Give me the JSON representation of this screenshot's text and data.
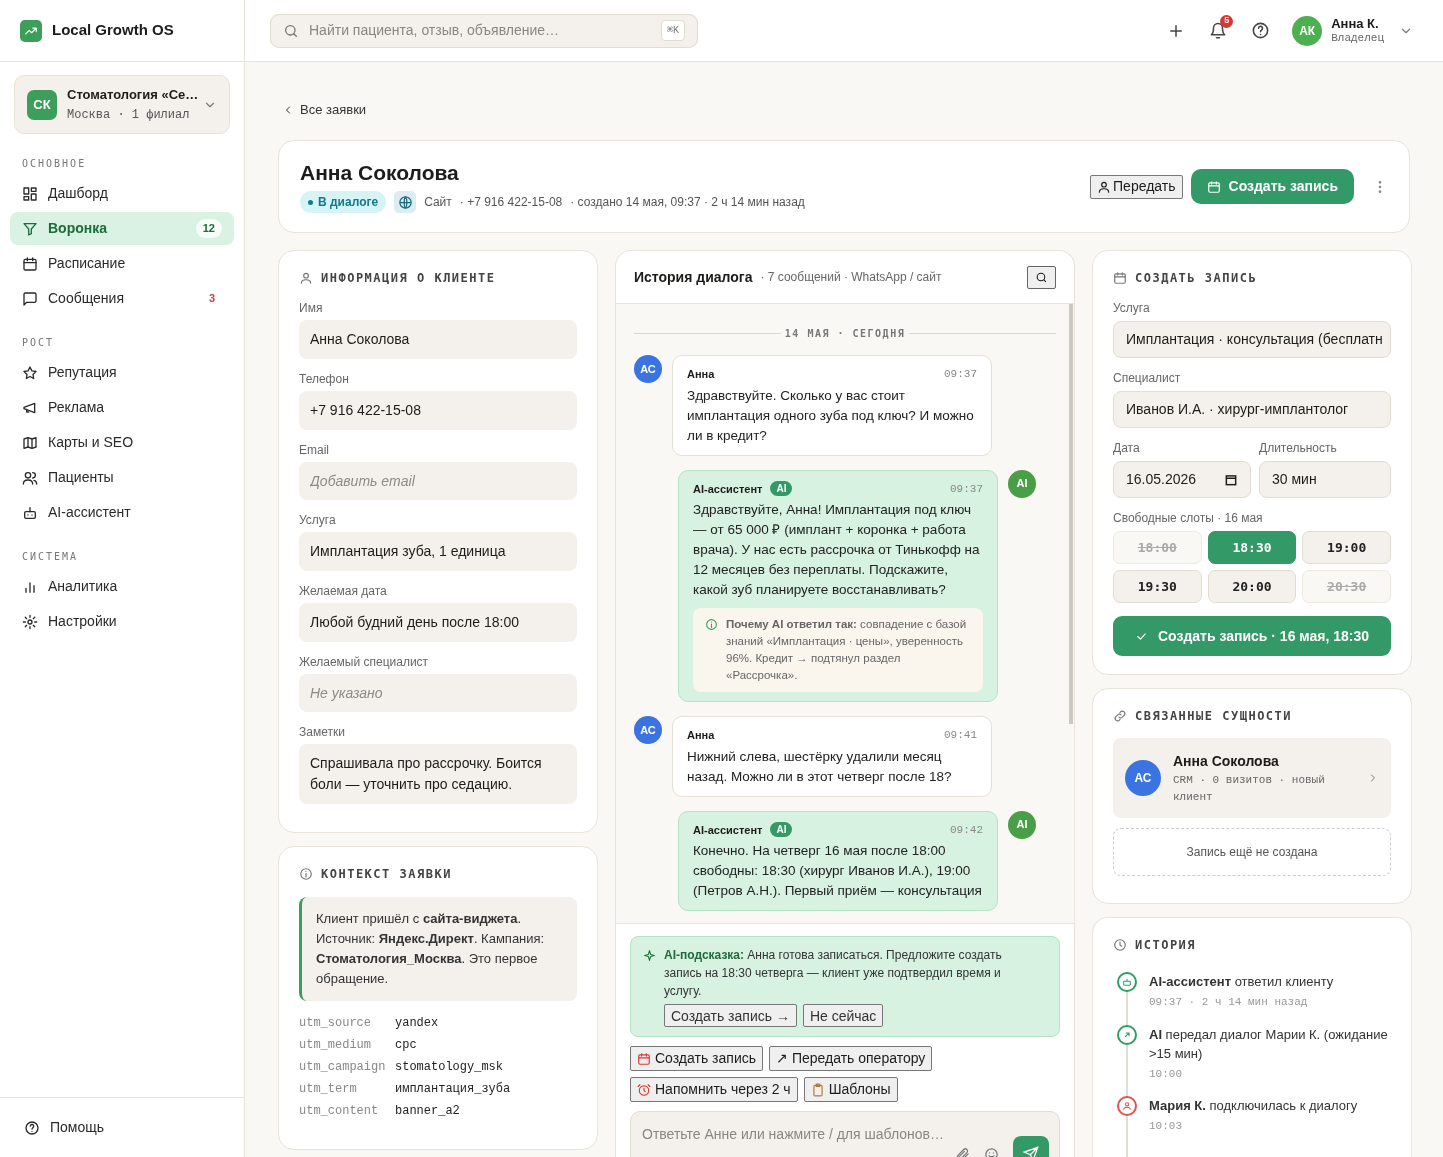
{
  "app": {
    "name": "Local Growth OS"
  },
  "search": {
    "placeholder": "Найти пациента, отзыв, объявление…",
    "shortcut": "⌘K"
  },
  "topbar": {
    "notifications": "5",
    "user": {
      "initials": "АК",
      "name": "Анна К.",
      "role": "Владелец"
    }
  },
  "org": {
    "initials": "СК",
    "name": "Стоматология «Се…",
    "meta": "Москва · 1 филиал"
  },
  "nav": [
    {
      "section": "ОСНОВНОЕ",
      "items": [
        {
          "label": "Дашборд",
          "selected": false
        },
        {
          "label": "Воронка",
          "selected": true,
          "badge": {
            "text": "12",
            "color": "#1f6b3d"
          }
        },
        {
          "label": "Расписание",
          "selected": false
        },
        {
          "label": "Сообщения",
          "selected": false,
          "badge": {
            "text": "3",
            "color": "#d23b3b"
          }
        }
      ]
    },
    {
      "section": "РОСТ",
      "items": [
        {
          "label": "Репутация",
          "selected": false
        },
        {
          "label": "Реклама",
          "selected": false
        },
        {
          "label": "Карты и SEO",
          "selected": false
        },
        {
          "label": "Пациенты",
          "selected": false
        },
        {
          "label": "AI-ассистент",
          "selected": false
        }
      ]
    },
    {
      "section": "СИСТЕМА",
      "items": [
        {
          "label": "Аналитика",
          "selected": false
        },
        {
          "label": "Настройки",
          "selected": false
        }
      ]
    }
  ],
  "help": "Помощь",
  "back": "Все заявки",
  "lead": {
    "name": "Анна Соколова",
    "status": "В диалоге",
    "source": "Сайт",
    "phone": "· +7 916 422-15-08",
    "created": "· создано 14 мая, 09:37 · 2 ч 14 мин назад",
    "actions": {
      "transfer": "Передать",
      "create": "Создать запись"
    }
  },
  "client_info": {
    "title": "ИНФОРМАЦИЯ О КЛИЕНТЕ",
    "fields": [
      {
        "label": "Имя",
        "value": "Анна Соколова"
      },
      {
        "label": "Телефон",
        "value": "+7 916 422-15-08"
      },
      {
        "label": "Email",
        "placeholder": "Добавить email"
      },
      {
        "label": "Услуга",
        "value": "Имплантация зуба, 1 единица"
      },
      {
        "label": "Желаемая дата",
        "value": "Любой будний день после 18:00"
      },
      {
        "label": "Желаемый специалист",
        "placeholder": "Не указано"
      },
      {
        "label": "Заметки",
        "value": "Спрашивала про рассрочку. Боится боли — уточнить про седацию."
      }
    ]
  },
  "context": {
    "title": "КОНТЕКСТ ЗАЯВКИ",
    "text": "Клиент пришёл с **сайта-виджета**. Источник: **Яндекс.Директ**. Кампания: **Стоматология_Москва**. Это первое обращение.",
    "utm": [
      {
        "key": "utm_source",
        "value": "yandex"
      },
      {
        "key": "utm_medium",
        "value": "cpc"
      },
      {
        "key": "utm_campaign",
        "value": "stomatology_msk"
      },
      {
        "key": "utm_term",
        "value": "имплантация_зуба"
      },
      {
        "key": "utm_content",
        "value": "banner_a2"
      }
    ]
  },
  "dialog": {
    "title": "История диалога",
    "meta": "· 7 сообщений · WhatsApp / сайт",
    "date_divider": "14 МАЯ · СЕГОДНЯ",
    "messages": [
      {
        "kind": "client",
        "avatar": "АС",
        "author": "Анна",
        "time": "09:37",
        "text": "Здравствуйте. Сколько у вас стоит имплантация одного зуба под ключ? И можно ли в кредит?"
      },
      {
        "kind": "ai",
        "avatar": "AI",
        "author": "AI-ассистент",
        "badge": "AI",
        "time": "09:37",
        "text": "Здравствуйте, Анна! Имплантация под ключ — от 65 000 ₽ (имплант + коронка + работа врача). У нас есть рассрочка от Тинькофф на 12 месяцев без переплаты. Подскажите, какой зуб планируете восстанавливать?",
        "why": "**Почему AI ответил так:** совпадение с базой знаний «Имплантация · цены», уверенность 96%. Кредит → подтянул раздел «Рассрочка»."
      },
      {
        "kind": "client",
        "avatar": "АС",
        "author": "Анна",
        "time": "09:41",
        "text": "Нижний слева, шестёрку удалили месяц назад. Можно ли в этот четверг после 18?"
      },
      {
        "kind": "ai",
        "avatar": "AI",
        "author": "AI-ассистент",
        "badge": "AI",
        "time": "09:42",
        "text": "Конечно. На четверг 16 мая после 18:00 свободны: 18:30 (хирург Иванов И.А.), 19:00 (Петров А.Н.). Первый приём — консультация"
      }
    ],
    "hint": {
      "text": "**AI-подсказка:** Анна готова записаться. Предложите создать запись на 18:30 четверга — клиент уже подтвердил время и услугу.",
      "accept": "Создать запись →",
      "dismiss": "Не сейчас"
    },
    "quick_actions": [
      {
        "kind": "calendar",
        "label": "Создать запись"
      },
      {
        "kind": "none",
        "label": "↗ Передать оператору"
      },
      {
        "kind": "alarm",
        "label": "Напомнить через 2 ч"
      },
      {
        "kind": "clipboard",
        "label": "Шаблоны"
      }
    ],
    "composer": {
      "placeholder": "Ответьте Анне или нажмите / для шаблонов…"
    }
  },
  "booking": {
    "title": "СОЗДАТЬ ЗАПИСЬ",
    "service_label": "Услуга",
    "service": "Имплантация · консультация (бесплатн",
    "specialist_label": "Специалист",
    "specialist": "Иванов И.А. · хирург-имплантолог",
    "date_label": "Дата",
    "date": "16.05.2026",
    "duration_label": "Длительность",
    "duration": "30 мин",
    "slots_label": "Свободные слоты · 16 мая",
    "slots": [
      {
        "time": "18:00",
        "selected": false,
        "disabled": true
      },
      {
        "time": "18:30",
        "selected": true,
        "disabled": false
      },
      {
        "time": "19:00",
        "selected": false,
        "disabled": false
      },
      {
        "time": "19:30",
        "selected": false,
        "disabled": false
      },
      {
        "time": "20:00",
        "selected": false,
        "disabled": false
      },
      {
        "time": "20:30",
        "selected": false,
        "disabled": true
      }
    ],
    "submit": "Создать запись · 16 мая, 18:30"
  },
  "related": {
    "title": "СВЯЗАННЫЕ СУЩНОСТИ",
    "contact": {
      "initials": "АС",
      "name": "Анна Соколова",
      "meta": "CRM · 0 визитов · новый клиент"
    },
    "empty": "Запись ещё не создана"
  },
  "history": {
    "title": "ИСТОРИЯ",
    "items": [
      {
        "kind": "robot",
        "color": "#2f9e62",
        "text": "**AI-ассистент** ответил клиенту",
        "time": "09:37 · 2 ч 14 мин назад"
      },
      {
        "kind": "arrow",
        "color": "#2f9e62",
        "text": "**AI** передал диалог Марии К. (ожидание >15 мин)",
        "time": "10:00"
      },
      {
        "kind": "person",
        "color": "#e05252",
        "text": "**Мария К.** подключилась к диалогу",
        "time": "10:03"
      }
    ]
  }
}
